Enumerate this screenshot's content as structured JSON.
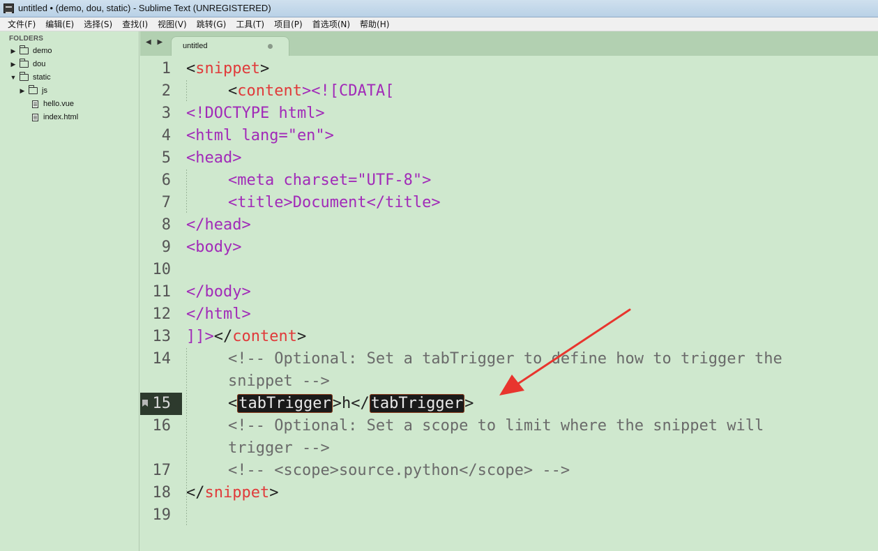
{
  "window": {
    "title": "untitled • (demo, dou, static) - Sublime Text (UNREGISTERED)"
  },
  "menu": [
    "文件(F)",
    "编辑(E)",
    "选择(S)",
    "查找(I)",
    "视图(V)",
    "跳转(G)",
    "工具(T)",
    "项目(P)",
    "首选项(N)",
    "帮助(H)"
  ],
  "sidebar": {
    "header": "FOLDERS",
    "items": [
      {
        "label": "demo",
        "type": "folder",
        "expanded": false
      },
      {
        "label": "dou",
        "type": "folder",
        "expanded": false
      },
      {
        "label": "static",
        "type": "folder",
        "expanded": true
      },
      {
        "label": "js",
        "type": "folder",
        "expanded": false
      },
      {
        "label": "hello.vue",
        "type": "file"
      },
      {
        "label": "index.html",
        "type": "file"
      }
    ]
  },
  "tabs": {
    "nav": "◀ ▶",
    "active": {
      "label": "untitled",
      "dirty": true
    }
  },
  "editor": {
    "current_line": 15,
    "line_numbers": [
      "1",
      "2",
      "3",
      "4",
      "5",
      "6",
      "7",
      "8",
      "9",
      "10",
      "11",
      "12",
      "13",
      "14",
      "15",
      "16",
      "17",
      "18",
      "19"
    ],
    "lines": {
      "l1_a": "<",
      "l1_b": "snippet",
      "l1_c": ">",
      "l2_a": "<",
      "l2_b": "content",
      "l2_c": "><![CDATA[",
      "l3": "<!DOCTYPE html>",
      "l4": "<html lang=\"en\">",
      "l5": "<head>",
      "l6": "<meta charset=\"UTF-8\">",
      "l7": "<title>Document</title>",
      "l8": "</head>",
      "l9": "<body>",
      "l11": "</body>",
      "l12": "</html>",
      "l13_a": "]]>",
      "l13_b": "</",
      "l13_c": "content",
      "l13_d": ">",
      "l14_a": "<!-- Optional: Set a tabTrigger to define how to trigger the",
      "l14_b": "snippet -->",
      "l15_a": "<",
      "l15_b": "tabTrigger",
      "l15_c": ">h</",
      "l15_d": "tabTrigger",
      "l15_e": ">",
      "l16_a": "<!-- Optional: Set a scope to limit where the snippet will",
      "l16_b": "trigger -->",
      "l17": "<!-- <scope>source.python</scope> -->",
      "l18_a": "</",
      "l18_b": "snippet",
      "l18_c": ">"
    }
  },
  "colors": {
    "background": "#cfe8ce",
    "tag": "#a12ab8",
    "element_name": "#e03a3a",
    "comment": "#6a6a6a",
    "arrow": "#e8352e"
  }
}
